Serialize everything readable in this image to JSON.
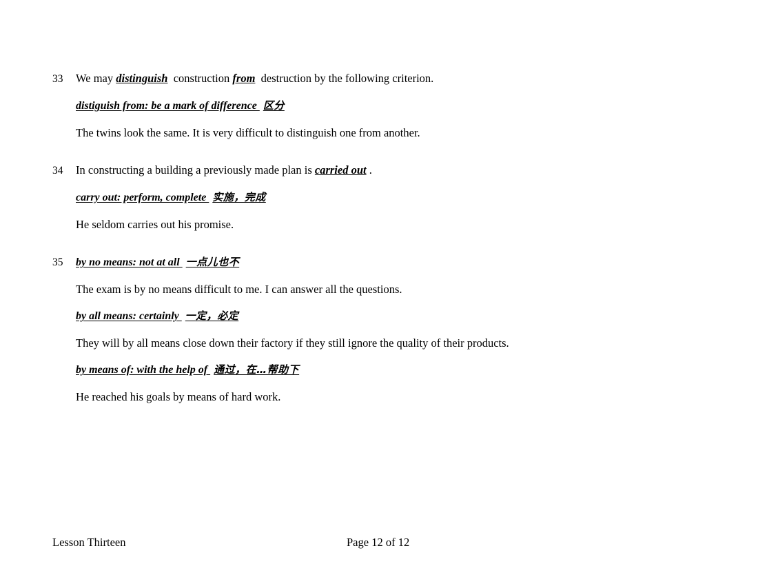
{
  "document": {
    "footer": {
      "lesson": "Lesson Thirteen",
      "page_label": "Page 12 of 12"
    }
  },
  "entries": [
    {
      "number": "33",
      "headline": "We may distinguish  construction from  destruction by the following criterion.",
      "headline_parts": {
        "before": "We may ",
        "term1": "distinguish",
        "middle": "  construction ",
        "term2": "from",
        "after": "  destruction by the following criterion."
      },
      "definition": {
        "english": "distiguish from: be a mark of difference ",
        "chinese": "区分"
      },
      "example": "The twins look the same. It is very difficult to distinguish one from another."
    },
    {
      "number": "34",
      "headline": "In constructing a building a previously made plan is carried out .",
      "headline_parts": {
        "before": "In constructing a building a previously made plan is ",
        "term1": "carried out",
        "middle": "",
        "term2": "",
        "after": " ."
      },
      "definition": {
        "english": "carry out: perform, complete ",
        "chinese": "实施，完成"
      },
      "example": "He seldom carries out his promise."
    },
    {
      "number": "35",
      "definition": {
        "english": "by no means: not at all ",
        "chinese": "一点儿也不"
      },
      "example": "The exam is by no means difficult to me. I can answer all the questions.",
      "definition2": {
        "english": "by all means: certainly ",
        "chinese": "一定，必定"
      },
      "example2": "They will by all means close down their factory if they still ignore the quality of their products.",
      "definition3": {
        "english": "by means of: with the help of ",
        "chinese": "通过，在…帮助下"
      },
      "example3": "He reached his goals by means of hard work."
    }
  ]
}
